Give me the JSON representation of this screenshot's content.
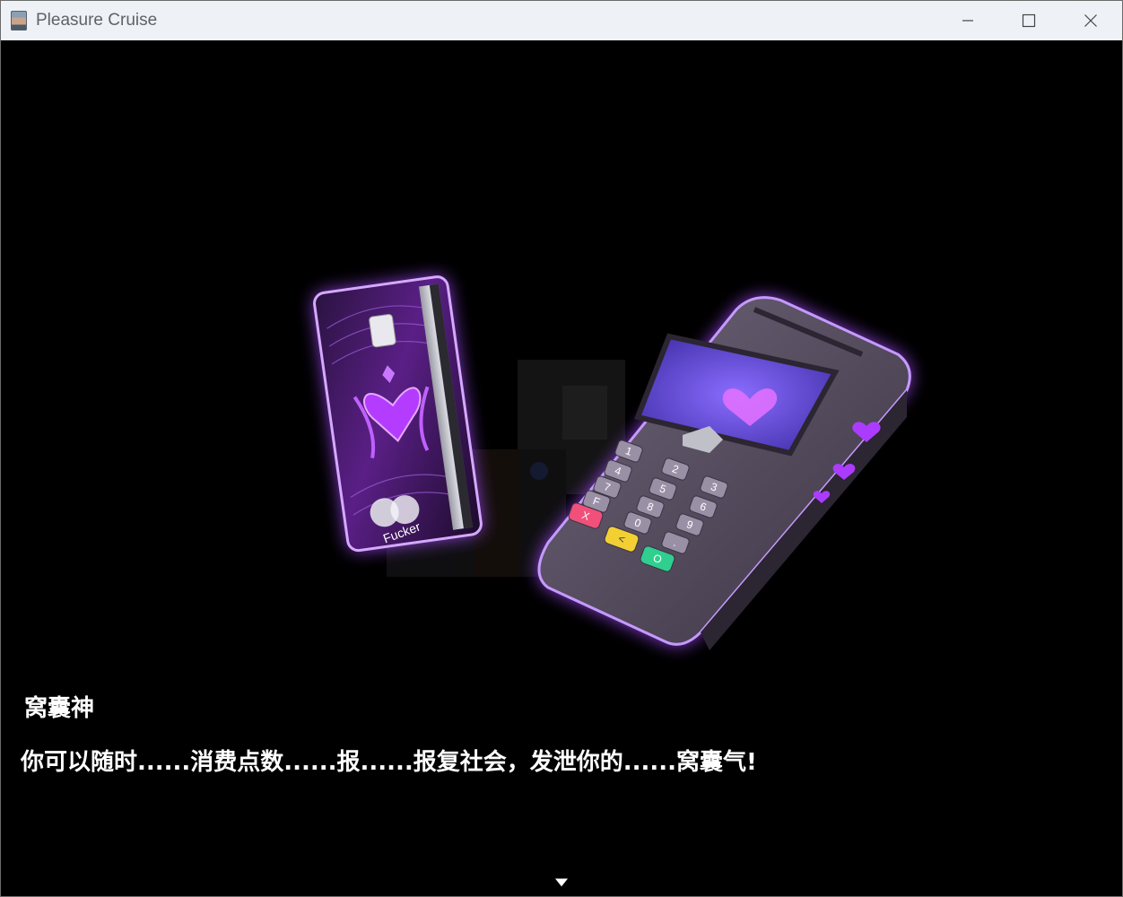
{
  "window": {
    "title": "Pleasure Cruise",
    "icon": "app-portrait-icon",
    "controls": [
      "minimize-icon",
      "maximize-icon",
      "close-icon"
    ]
  },
  "scene": {
    "card_label": "Fucker",
    "pos_keys": [
      "1",
      "2",
      "3",
      "4",
      "5",
      "6",
      "7",
      "8",
      "9",
      "F",
      "0",
      "."
    ],
    "pos_action_keys": [
      "X",
      "<",
      "O"
    ],
    "glow_color": "#a44bff",
    "screen_color": "#6a4cf0",
    "heart_color": "#e070ff"
  },
  "dialogue": {
    "speaker": "窝囊神",
    "text": "你可以随时......消费点数......报......报复社会，发泄你的......窝囊气!",
    "advance_indicator": "down-triangle-icon"
  }
}
